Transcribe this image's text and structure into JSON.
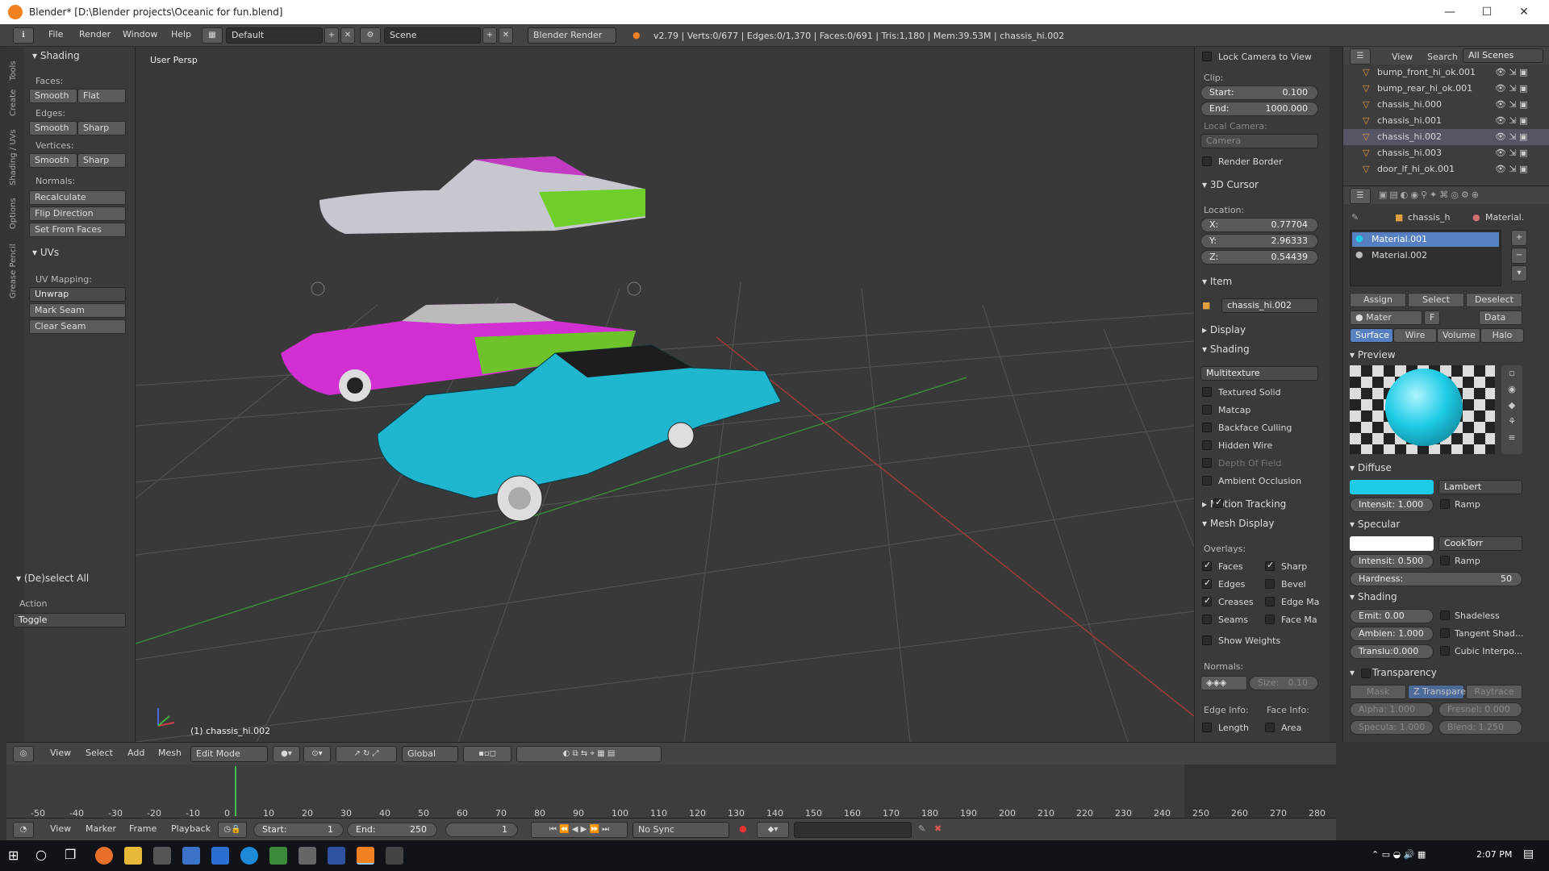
{
  "window": {
    "title": "Blender* [D:\\Blender projects\\Oceanic for fun.blend]",
    "min": "—",
    "max": "☐",
    "close": "✕"
  },
  "info": {
    "menus": [
      "File",
      "Render",
      "Window",
      "Help"
    ],
    "layout": "Default",
    "scene": "Scene",
    "engine": "Blender Render",
    "stats": "v2.79 | Verts:0/677 | Edges:0/1,370 | Faces:0/691 | Tris:1,180 | Mem:39.53M | chassis_hi.002"
  },
  "tools": {
    "tabs": [
      "Tools",
      "Create",
      "Shading / UVs",
      "Options",
      "Grease Pencil"
    ],
    "shading_header": "Shading",
    "faces_label": "Faces:",
    "smooth": "Smooth",
    "flat": "Flat",
    "edges_label": "Edges:",
    "sharp": "Sharp",
    "vertices_label": "Vertices:",
    "normals_label": "Normals:",
    "recalculate": "Recalculate",
    "flip_direction": "Flip Direction",
    "set_from_faces": "Set From Faces",
    "uvs_header": "UVs",
    "uv_mapping_label": "UV Mapping:",
    "unwrap": "Unwrap",
    "mark_seam": "Mark Seam",
    "clear_seam": "Clear Seam",
    "deselect_header": "(De)select All",
    "action_label": "Action",
    "action_value": "Toggle"
  },
  "viewport": {
    "label": "User Persp",
    "object_label": "(1) chassis_hi.002"
  },
  "nprops": {
    "lock_camera": "Lock Camera to View",
    "clip_label": "Clip:",
    "start_label": "Start:",
    "start_val": "0.100",
    "end_label": "End:",
    "end_val": "1000.000",
    "local_camera": "Local Camera:",
    "camera": "Camera",
    "render_border": "Render Border",
    "cursor_header": "3D Cursor",
    "location_label": "Location:",
    "x_label": "X:",
    "x_val": "0.77704",
    "y_label": "Y:",
    "y_val": "2.96333",
    "z_label": "Z:",
    "z_val": "0.54439",
    "item_header": "Item",
    "item_name": "chassis_hi.002",
    "display_header": "Display",
    "shading_header": "Shading",
    "shading_mode": "Multitexture",
    "shading_opts": [
      "Textured Solid",
      "Matcap",
      "Backface Culling",
      "Hidden Wire",
      "Depth Of Field",
      "Ambient Occlusion"
    ],
    "motion_tracking": "Motion Tracking",
    "mesh_display": "Mesh Display",
    "overlays_label": "Overlays:",
    "overlays_left": [
      "Faces",
      "Edges",
      "Creases",
      "Seams",
      "Show Weights"
    ],
    "overlays_right": [
      "Sharp",
      "Bevel",
      "Edge Ma",
      "Face Ma"
    ],
    "normals_label": "Normals:",
    "size_label": "Size:",
    "size_val": "0.10",
    "edge_info": "Edge Info:",
    "face_info": "Face Info:",
    "length": "Length",
    "area": "Area"
  },
  "outliner": {
    "view": "View",
    "search": "Search",
    "all_scenes": "All Scenes",
    "items": [
      "bump_front_hi_ok.001",
      "bump_rear_hi_ok.001",
      "chassis_hi.000",
      "chassis_hi.001",
      "chassis_hi.002",
      "chassis_hi.003",
      "door_lf_hi_ok.001"
    ]
  },
  "props": {
    "breadcrumb_obj": "chassis_h",
    "breadcrumb_mat": "Material.",
    "materials": [
      "Material.001",
      "Material.002"
    ],
    "assign": "Assign",
    "select": "Select",
    "deselect": "Deselect",
    "mat_field": "Mater",
    "f": "F",
    "data": "Data",
    "tabs": [
      "Surface",
      "Wire",
      "Volume",
      "Halo"
    ],
    "preview_header": "Preview",
    "diffuse_header": "Diffuse",
    "diffuse_shader": "Lambert",
    "diffuse_intensity": "Intensit: 1.000",
    "ramp": "Ramp",
    "specular_header": "Specular",
    "spec_shader": "CookTorr",
    "spec_intensity": "Intensit: 0.500",
    "hardness_label": "Hardness:",
    "hardness_val": "50",
    "shading_header": "Shading",
    "emit": "Emit: 0.00",
    "ambient": "Ambien: 1.000",
    "translucency": "Translu:0.000",
    "shadeless": "Shadeless",
    "tangent": "Tangent Shad...",
    "cubic": "Cubic Interpo...",
    "transparency_header": "Transparency",
    "trans_tabs": [
      "Mask",
      "Z Transpare...",
      "Raytrace"
    ],
    "alpha": "Alpha: 1.000",
    "fresnel": "Fresnel: 0.000",
    "specular_val": "Specula: 1.000",
    "blend": "Blend: 1.250",
    "diffuse_color": "#1ecbe6",
    "spec_color": "#ffffff"
  },
  "vt": {
    "menus": [
      "View",
      "Select",
      "Add",
      "Mesh"
    ],
    "mode": "Edit Mode",
    "orientation": "Global"
  },
  "timeline": {
    "ticks": [
      "-50",
      "-40",
      "-30",
      "-20",
      "-10",
      "0",
      "10",
      "20",
      "30",
      "40",
      "50",
      "60",
      "70",
      "80",
      "90",
      "100",
      "110",
      "120",
      "130",
      "140",
      "150",
      "160",
      "170",
      "180",
      "190",
      "200",
      "210",
      "220",
      "230",
      "240",
      "250",
      "260",
      "270",
      "280"
    ],
    "menus": [
      "View",
      "Marker",
      "Frame",
      "Playback"
    ],
    "start": "Start:",
    "start_val": "1",
    "end": "End:",
    "end_val": "250",
    "current": "1",
    "sync": "No Sync"
  },
  "taskbar": {
    "time": "2:07 PM"
  }
}
